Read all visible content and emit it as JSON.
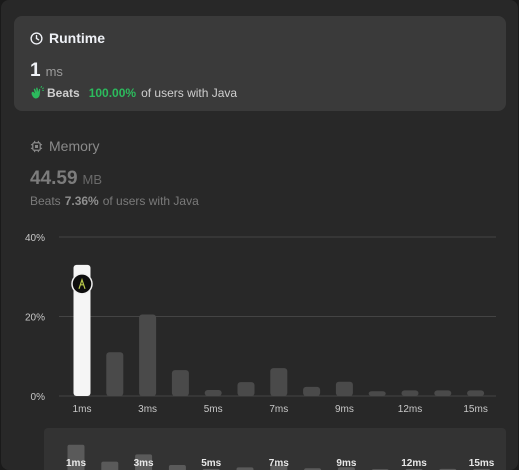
{
  "runtime": {
    "title": "Runtime",
    "value": "1",
    "unit": "ms",
    "beats_label": "Beats",
    "beats_percent": "100.00%",
    "beats_suffix": "of users with Java"
  },
  "memory": {
    "title": "Memory",
    "value": "44.59",
    "unit": "MB",
    "beats_label": "Beats",
    "beats_percent": "7.36%",
    "beats_suffix": "of users with Java"
  },
  "colors": {
    "green": "#2cbb5d",
    "selected_bar": "#f5f5f5",
    "bar": "#4a4a4a",
    "grid": "#444444"
  },
  "chart_data": {
    "type": "bar",
    "y_tick_labels": [
      "40%",
      "20%",
      "0%"
    ],
    "ylim": [
      0,
      40
    ],
    "x_tick_labels": [
      "1ms",
      "3ms",
      "5ms",
      "7ms",
      "9ms",
      "12ms",
      "15ms"
    ],
    "values": [
      33,
      11,
      20.5,
      6.5,
      1.5,
      3.5,
      7,
      2.3,
      3.6,
      1.2,
      1.4,
      1.4,
      1.4
    ],
    "selected_index": 0,
    "marker_icon": "user-avatar-icon",
    "overview_values": [
      33,
      11,
      20.5,
      6.5,
      1.5,
      3.5,
      7,
      2.3,
      3.6,
      1.2,
      1.4,
      1.4,
      1.4
    ]
  }
}
